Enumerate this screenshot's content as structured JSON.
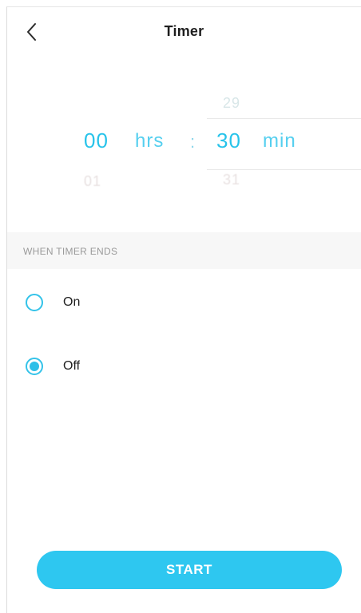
{
  "header": {
    "title": "Timer",
    "back_icon": "chevron-left-icon"
  },
  "picker": {
    "hours": {
      "above": "",
      "selected": "00",
      "below": "01",
      "unit": "hrs"
    },
    "separator": ":",
    "minutes": {
      "above": "29",
      "selected": "30",
      "below": "31",
      "unit": "min"
    }
  },
  "section": {
    "label": "WHEN TIMER ENDS"
  },
  "options": [
    {
      "label": "On",
      "checked": false
    },
    {
      "label": "Off",
      "checked": true
    }
  ],
  "action": {
    "start_label": "START"
  },
  "colors": {
    "accent": "#2ec7f0",
    "picker_selected": "#27c3ea",
    "section_bg": "#f7f7f7",
    "section_text": "#9a9a9a"
  }
}
